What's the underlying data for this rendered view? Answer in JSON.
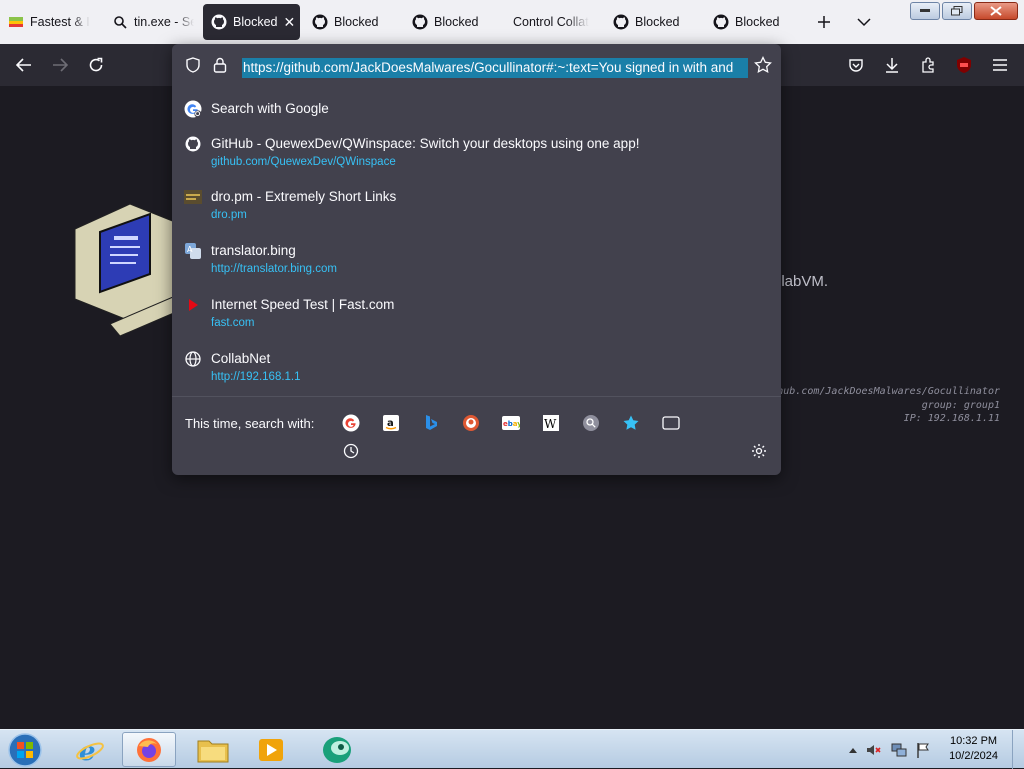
{
  "tabs": [
    {
      "label": "Fastest & I",
      "active": false
    },
    {
      "label": "tin.exe - Se",
      "active": false
    },
    {
      "label": "Blocked",
      "active": true
    },
    {
      "label": "Blocked",
      "active": false
    },
    {
      "label": "Blocked",
      "active": false
    },
    {
      "label": "Control Collat",
      "active": false
    },
    {
      "label": "Blocked",
      "active": false
    },
    {
      "label": "Blocked",
      "active": false
    }
  ],
  "url": "https://github.com/JackDoesMalwares/Gocullinator#:~:text=You signed in with and",
  "results": [
    {
      "title": "Search with Google",
      "url": "",
      "icon": "google-icon"
    },
    {
      "title": "GitHub - QuewexDev/QWinspace: Switch your desktops using one app!",
      "url": "github.com/QuewexDev/QWinspace",
      "icon": "github-icon"
    },
    {
      "title": "dro.pm - Extremely Short Links",
      "url": "dro.pm",
      "icon": "dropm-icon"
    },
    {
      "title": "translator.bing",
      "url": "http://translator.bing.com",
      "icon": "translator-icon"
    },
    {
      "title": "Internet Speed Test | Fast.com",
      "url": "fast.com",
      "icon": "fast-icon"
    },
    {
      "title": "CollabNet",
      "url": "http://192.168.1.1",
      "icon": "globe-icon"
    }
  ],
  "search_with_label": "This time, search with:",
  "page": {
    "partial_text": "llabVM.",
    "info_line1": "hub.com/JackDoesMalwares/Gocullinator",
    "info_line2": "group: group1",
    "info_line3": "IP: 192.168.1.11"
  },
  "clock": {
    "time": "10:32 PM",
    "date": "10/2/2024"
  },
  "colors": {
    "accent": "#37c1f5",
    "selection": "#1a7fa8",
    "panel": "#42414d"
  }
}
